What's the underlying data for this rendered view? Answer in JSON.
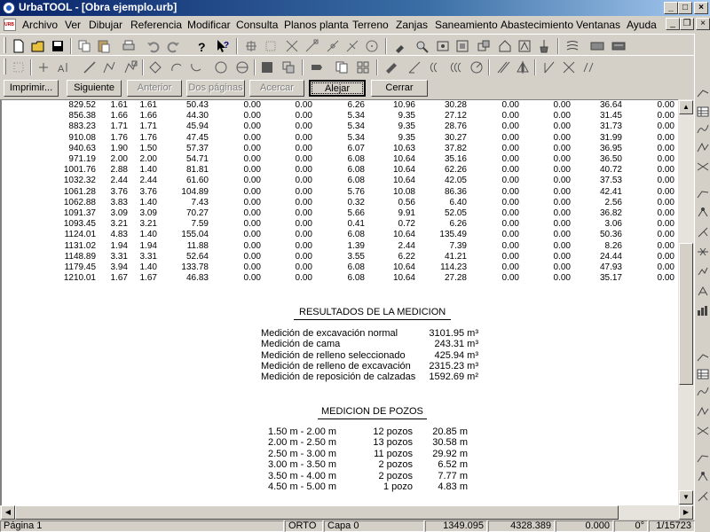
{
  "window": {
    "title": "UrbaTOOL - [Obra ejemplo.urb]"
  },
  "menu": [
    "Archivo",
    "Ver",
    "Dibujar",
    "Referencia",
    "Modificar",
    "Consulta",
    "Planos planta",
    "Terreno",
    "Zanjas",
    "Saneamiento",
    "Abastecimiento",
    "Ventanas",
    "Ayuda"
  ],
  "preview_buttons": {
    "print": "Imprimir...",
    "next": "Siguiente",
    "previous": "Anterior",
    "two_pages": "Dos páginas",
    "zoom_in": "Acercar",
    "zoom_out": "Alejar",
    "close": "Cerrar"
  },
  "measurement_rows": [
    [
      "829.52",
      "1.61",
      "1.61",
      "50.43",
      "0.00",
      "0.00",
      "6.26",
      "10.96",
      "30.28",
      "0.00",
      "0.00",
      "36.64",
      "0.00"
    ],
    [
      "856.38",
      "1.66",
      "1.66",
      "44.30",
      "0.00",
      "0.00",
      "5.34",
      "9.35",
      "27.12",
      "0.00",
      "0.00",
      "31.45",
      "0.00"
    ],
    [
      "883.23",
      "1.71",
      "1.71",
      "45.94",
      "0.00",
      "0.00",
      "5.34",
      "9.35",
      "28.76",
      "0.00",
      "0.00",
      "31.73",
      "0.00"
    ],
    [
      "910.08",
      "1.76",
      "1.76",
      "47.45",
      "0.00",
      "0.00",
      "5.34",
      "9.35",
      "30.27",
      "0.00",
      "0.00",
      "31.99",
      "0.00"
    ],
    [
      "940.63",
      "1.90",
      "1.50",
      "57.37",
      "0.00",
      "0.00",
      "6.07",
      "10.63",
      "37.82",
      "0.00",
      "0.00",
      "36.95",
      "0.00"
    ],
    [
      "971.19",
      "2.00",
      "2.00",
      "54.71",
      "0.00",
      "0.00",
      "6.08",
      "10.64",
      "35.16",
      "0.00",
      "0.00",
      "36.50",
      "0.00"
    ],
    [
      "1001.76",
      "2.88",
      "1.40",
      "81.81",
      "0.00",
      "0.00",
      "6.08",
      "10.64",
      "62.26",
      "0.00",
      "0.00",
      "40.72",
      "0.00"
    ],
    [
      "1032.32",
      "2.44",
      "2.44",
      "61.60",
      "0.00",
      "0.00",
      "6.08",
      "10.64",
      "42.05",
      "0.00",
      "0.00",
      "37.53",
      "0.00"
    ],
    [
      "1061.28",
      "3.76",
      "3.76",
      "104.89",
      "0.00",
      "0.00",
      "5.76",
      "10.08",
      "86.36",
      "0.00",
      "0.00",
      "42.41",
      "0.00"
    ],
    [
      "1062.88",
      "3.83",
      "1.40",
      "7.43",
      "0.00",
      "0.00",
      "0.32",
      "0.56",
      "6.40",
      "0.00",
      "0.00",
      "2.56",
      "0.00"
    ],
    [
      "1091.37",
      "3.09",
      "3.09",
      "70.27",
      "0.00",
      "0.00",
      "5.66",
      "9.91",
      "52.05",
      "0.00",
      "0.00",
      "36.82",
      "0.00"
    ],
    [
      "1093.45",
      "3.21",
      "3.21",
      "7.59",
      "0.00",
      "0.00",
      "0.41",
      "0.72",
      "6.26",
      "0.00",
      "0.00",
      "3.06",
      "0.00"
    ],
    [
      "1124.01",
      "4.83",
      "1.40",
      "155.04",
      "0.00",
      "0.00",
      "6.08",
      "10.64",
      "135.49",
      "0.00",
      "0.00",
      "50.36",
      "0.00"
    ],
    [
      "1131.02",
      "1.94",
      "1.94",
      "11.88",
      "0.00",
      "0.00",
      "1.39",
      "2.44",
      "7.39",
      "0.00",
      "0.00",
      "8.26",
      "0.00"
    ],
    [
      "1148.89",
      "3.31",
      "3.31",
      "52.64",
      "0.00",
      "0.00",
      "3.55",
      "6.22",
      "41.21",
      "0.00",
      "0.00",
      "24.44",
      "0.00"
    ],
    [
      "1179.45",
      "3.94",
      "1.40",
      "133.78",
      "0.00",
      "0.00",
      "6.08",
      "10.64",
      "114.23",
      "0.00",
      "0.00",
      "47.93",
      "0.00"
    ],
    [
      "1210.01",
      "1.67",
      "1.67",
      "46.83",
      "0.00",
      "0.00",
      "6.08",
      "10.64",
      "27.28",
      "0.00",
      "0.00",
      "35.17",
      "0.00"
    ]
  ],
  "results": {
    "title": "RESULTADOS DE LA MEDICION",
    "items": [
      {
        "label": "Medición de excavación normal",
        "value": "3101.95 m³"
      },
      {
        "label": "Medición de cama",
        "value": "243.31 m³"
      },
      {
        "label": "Medición de relleno seleccionado",
        "value": "425.94 m³"
      },
      {
        "label": "Medición de relleno de excavación",
        "value": "2315.23 m³"
      },
      {
        "label": "Medición de reposición de calzadas",
        "value": "1592.69 m²"
      }
    ]
  },
  "wells": {
    "title": "MEDICION DE POZOS",
    "items": [
      {
        "range": "1.50 m - 2.00 m",
        "count": "12 pozos",
        "volume": "20.85 m"
      },
      {
        "range": "2.00 m - 2.50 m",
        "count": "13 pozos",
        "volume": "30.58 m"
      },
      {
        "range": "2.50 m - 3.00 m",
        "count": "11 pozos",
        "volume": "29.92 m"
      },
      {
        "range": "3.00 m - 3.50 m",
        "count": "2 pozos",
        "volume": "6.52 m"
      },
      {
        "range": "3.50 m - 4.00 m",
        "count": "2 pozos",
        "volume": "7.77 m"
      },
      {
        "range": "4.50 m - 5.00 m",
        "count": "1 pozo",
        "volume": "4.83 m"
      }
    ]
  },
  "status": {
    "page": "Página 1",
    "mode": "ORTO",
    "layer": "Capa 0",
    "x": "1349.095",
    "y": "4328.389",
    "z": "0.000",
    "angle": "0°",
    "scale": "1/15723"
  },
  "scroll": {
    "vertical_position": 0.55,
    "horizontal_position": 0
  }
}
